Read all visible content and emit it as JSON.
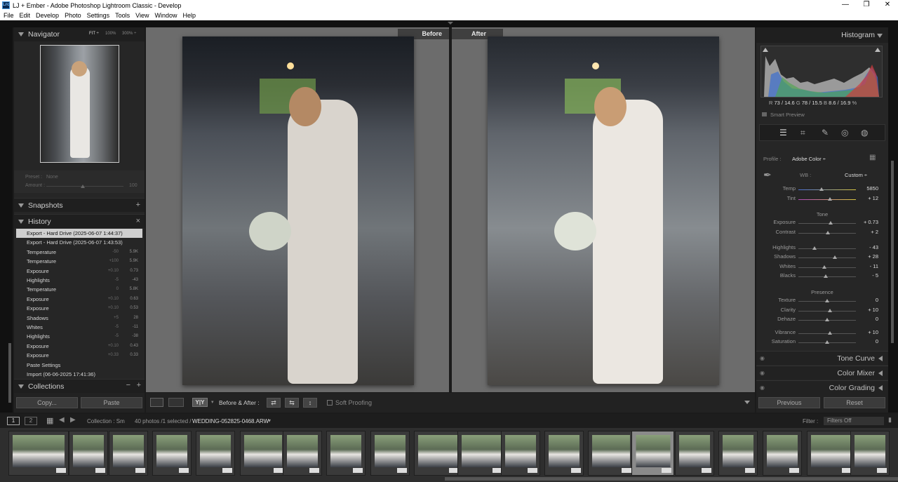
{
  "window": {
    "title": "LJ + Ember - Adobe Photoshop Lightroom Classic - Develop",
    "app_icon": "Lrc",
    "controls": [
      "—",
      "❐",
      "✕"
    ]
  },
  "menu": [
    "File",
    "Edit",
    "Develop",
    "Photo",
    "Settings",
    "Tools",
    "View",
    "Window",
    "Help"
  ],
  "navigator": {
    "title": "Navigator",
    "zoom_options": [
      "FIT ÷",
      "100%",
      "300% ÷"
    ]
  },
  "preset": {
    "label": "Preset :",
    "value": "None",
    "amount_label": "Amount :",
    "amount_value": "100"
  },
  "snapshots": {
    "title": "Snapshots",
    "add": "+"
  },
  "history": {
    "title": "History",
    "close": "×",
    "items": [
      {
        "name": "Export - Hard Drive (2025-06-07 1:44:37)",
        "a": "",
        "b": ""
      },
      {
        "name": "Export - Hard Drive (2025-06-07 1:43:53)",
        "a": "",
        "b": ""
      },
      {
        "name": "Temperature",
        "a": "-50",
        "b": "5.9K"
      },
      {
        "name": "Temperature",
        "a": "+100",
        "b": "5.9K"
      },
      {
        "name": "Exposure",
        "a": "+0.10",
        "b": "0.73"
      },
      {
        "name": "Highlights",
        "a": "-5",
        "b": "-43"
      },
      {
        "name": "Temperature",
        "a": "0",
        "b": "5.8K"
      },
      {
        "name": "Exposure",
        "a": "+0.10",
        "b": "0.63"
      },
      {
        "name": "Exposure",
        "a": "+0.10",
        "b": "0.53"
      },
      {
        "name": "Shadows",
        "a": "+5",
        "b": "28"
      },
      {
        "name": "Whites",
        "a": "-5",
        "b": "-11"
      },
      {
        "name": "Highlights",
        "a": "-5",
        "b": "-38"
      },
      {
        "name": "Exposure",
        "a": "+0.10",
        "b": "0.43"
      },
      {
        "name": "Exposure",
        "a": "+0.33",
        "b": "0.33"
      },
      {
        "name": "Paste Settings",
        "a": "",
        "b": ""
      },
      {
        "name": "Import (06-06-2025 17:41:36)",
        "a": "",
        "b": ""
      }
    ]
  },
  "collections": {
    "title": "Collections",
    "minus": "−",
    "plus": "+"
  },
  "left_buttons": {
    "copy": "Copy...",
    "paste": "Paste"
  },
  "compare": {
    "before": "Before",
    "after": "After"
  },
  "toolbar": {
    "before_after_label": "Before & After :",
    "soft_proofing": "Soft Proofing",
    "view_yy": "Y|Y"
  },
  "histogram": {
    "title": "Histogram",
    "readout": {
      "r_label": "R",
      "r": "73 / 14.6",
      "g_label": "G",
      "g": "78 / 15.5",
      "b_label": "B",
      "b": "8.6 / 16.9",
      "pct": "%"
    },
    "smart_preview": "Smart Preview"
  },
  "basic": {
    "profile_label": "Profile :",
    "profile_value": "Adobe Color ÷",
    "wb_label": "WB :",
    "wb_value": "Custom ÷",
    "wb_sliders": [
      {
        "label": "Temp",
        "value": "5850",
        "pos": 0.4,
        "color": "#4a6fd6"
      },
      {
        "label": "Tint",
        "value": "+ 12",
        "pos": 0.55,
        "color": "#b04ab8"
      }
    ],
    "tone_label": "Tone",
    "tone_sliders": [
      {
        "label": "Exposure",
        "value": "+ 0.73",
        "pos": 0.56
      },
      {
        "label": "Contrast",
        "value": "+ 2",
        "pos": 0.51
      },
      {
        "label": "Highlights",
        "value": "- 43",
        "pos": 0.28
      },
      {
        "label": "Shadows",
        "value": "+ 28",
        "pos": 0.64
      },
      {
        "label": "Whites",
        "value": "- 11",
        "pos": 0.45
      },
      {
        "label": "Blacks",
        "value": "- 5",
        "pos": 0.48
      }
    ],
    "presence_label": "Presence",
    "presence_sliders": [
      {
        "label": "Texture",
        "value": "0",
        "pos": 0.5
      },
      {
        "label": "Clarity",
        "value": "+ 10",
        "pos": 0.55
      },
      {
        "label": "Dehaze",
        "value": "0",
        "pos": 0.5
      },
      {
        "label": "Vibrance",
        "value": "+ 10",
        "pos": 0.55
      },
      {
        "label": "Saturation",
        "value": "0",
        "pos": 0.5
      }
    ]
  },
  "panels": {
    "tone_curve": "Tone Curve",
    "color_mixer": "Color Mixer",
    "color_grading": "Color Grading"
  },
  "right_buttons": {
    "previous": "Previous",
    "reset": "Reset"
  },
  "filmstrip": {
    "screen1": "1",
    "screen2": "2",
    "source": "Collection : Sm",
    "count": "40 photos /1 selected /",
    "filename": "WEDDING-052825-0468.ARW",
    "filter_label": "Filter :",
    "filter_value": "Filters Off"
  },
  "colors": {
    "accent": "#d1d1d1",
    "panel_bg": "#262626",
    "header_bg": "#1f1f1f",
    "canvas_bg": "#6c6c6c"
  }
}
